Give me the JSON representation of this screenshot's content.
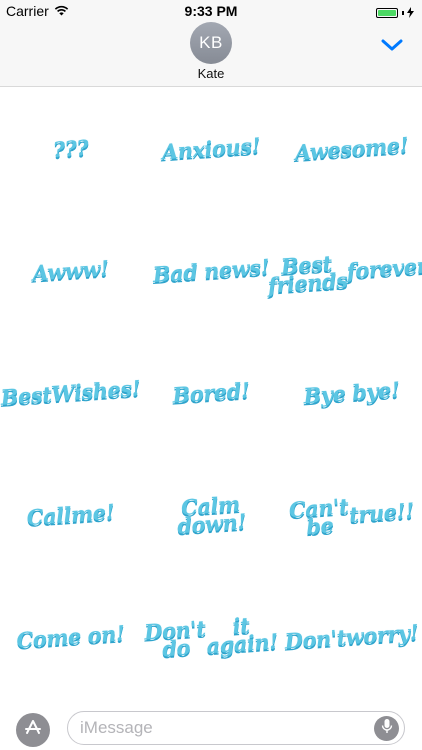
{
  "status_bar": {
    "carrier": "Carrier",
    "time": "9:33 PM"
  },
  "header": {
    "avatar_initials": "KB",
    "contact_name": "Kate"
  },
  "stickers": [
    [
      "???"
    ],
    [
      "Anxious!"
    ],
    [
      "Awesome!"
    ],
    [
      "Awww!"
    ],
    [
      "Bad news!"
    ],
    [
      "Best friends",
      "forever!"
    ],
    [
      "Best",
      "Wishes!"
    ],
    [
      "Bored!"
    ],
    [
      "Bye bye!"
    ],
    [
      "Call",
      "me!"
    ],
    [
      "Calm down!"
    ],
    [
      "Can't be",
      "true!!"
    ],
    [
      "Come on!"
    ],
    [
      "Don't do",
      "it again!"
    ],
    [
      "Don't",
      "worry!"
    ]
  ],
  "compose": {
    "placeholder": "iMessage"
  },
  "colors": {
    "sticker_fill": "#5cc6e3",
    "sticker_shadow": "#2fa4cc",
    "accent": "#007aff",
    "battery": "#4cd964"
  },
  "icons": {
    "signal": "wifi-icon",
    "charge": "charging-bolt-icon",
    "collapse": "chevron-down-icon",
    "apps": "app-store-icon",
    "dictation": "microphone-icon"
  }
}
